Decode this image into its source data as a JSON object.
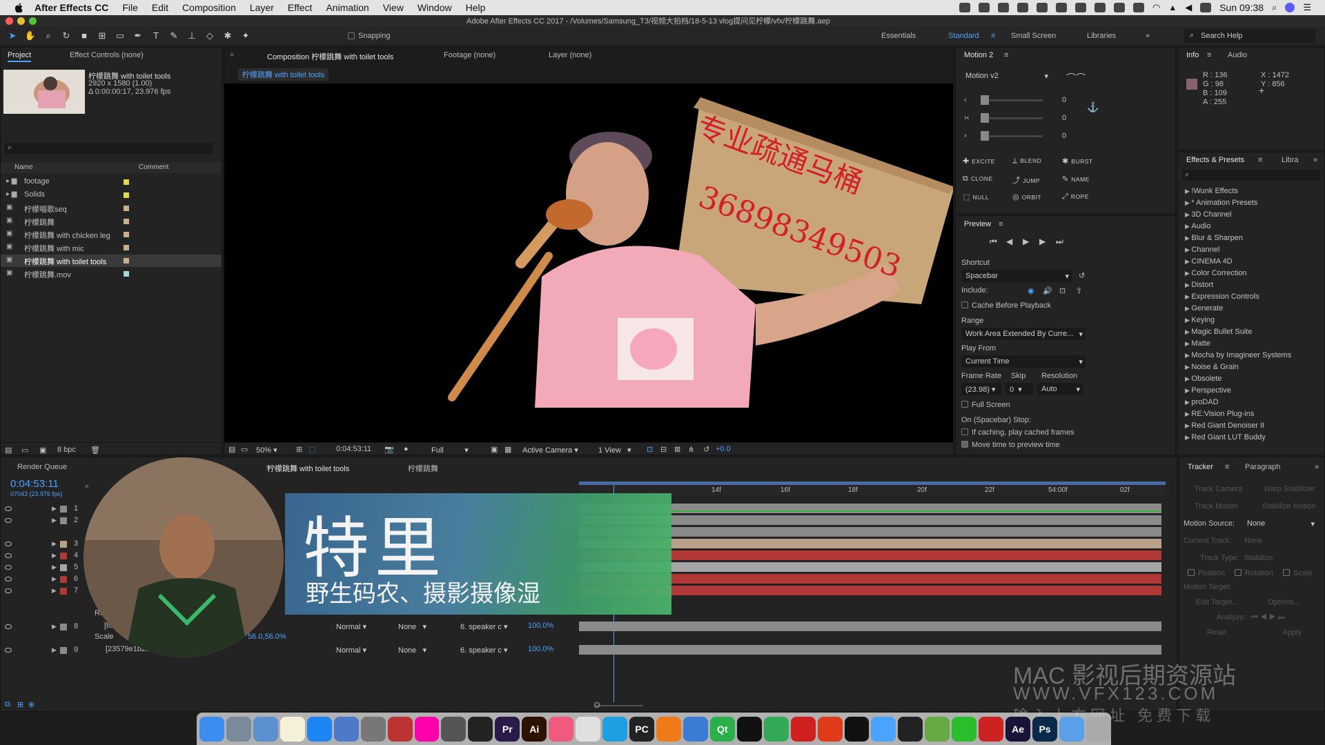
{
  "menubar": {
    "app": "After Effects CC",
    "items": [
      "File",
      "Edit",
      "Composition",
      "Layer",
      "Effect",
      "Animation",
      "View",
      "Window",
      "Help"
    ],
    "clock": "Sun 09:38"
  },
  "window_title": "Adobe After Effects CC 2017 - /Volumes/Samsung_T3/视频大拍档/18-5-13 vlog提问见柠檬/vfx/柠檬跳舞.aep",
  "toolbar": {
    "snapping_label": "Snapping",
    "workspaces": [
      "Essentials",
      "Standard",
      "Small Screen",
      "Libraries"
    ],
    "active_workspace": "Standard",
    "search_placeholder": "Search Help"
  },
  "project_panel": {
    "tabs": [
      "Project",
      "Effect Controls (none)"
    ],
    "selected_name": "柠檬跳舞 with toilet tools",
    "selected_dims": "2920 x 1580 (1.00)",
    "selected_duration": "Δ 0:00:00:17, 23.976 fps",
    "columns": [
      "Name",
      "Comment"
    ],
    "items": [
      {
        "name": "footage",
        "type": "folder",
        "color": "#e4d94b"
      },
      {
        "name": "Solids",
        "type": "folder",
        "color": "#e4d94b"
      },
      {
        "name": "柠檬唱歌seq",
        "type": "comp",
        "color": "#c8b08a"
      },
      {
        "name": "柠檬跳舞",
        "type": "comp",
        "color": "#c8b08a"
      },
      {
        "name": "柠檬跳舞 with chicken leg",
        "type": "comp",
        "color": "#c8b08a"
      },
      {
        "name": "柠檬跳舞 with mic",
        "type": "comp",
        "color": "#c8b08a"
      },
      {
        "name": "柠檬跳舞 with toilet tools",
        "type": "comp",
        "color": "#c8b08a"
      },
      {
        "name": "柠檬跳舞.mov",
        "type": "footage",
        "color": "#a8d8d8"
      }
    ],
    "bpc": "8 bpc"
  },
  "comp_panel": {
    "tabs": [
      "Composition 柠檬跳舞 with toilet tools",
      "Footage (none)",
      "Layer (none)"
    ],
    "breadcrumb": "柠檬跳舞 with toilet tools",
    "sign_text_top": "专业疏通马桶",
    "sign_text_phone": "36898349503",
    "zoom": "50%",
    "timecode": "0:04:53:11",
    "resolution": "Full",
    "camera": "Active Camera",
    "views": "1 View",
    "exposure": "+0.0"
  },
  "motion_panel": {
    "title": "Motion 2",
    "preset": "Motion v2",
    "slider_values": [
      "0",
      "0",
      "0"
    ],
    "buttons": [
      "EXCITE",
      "BLEND",
      "BURST",
      "CLONE",
      "JUMP",
      "NAME",
      "NULL",
      "ORBIT",
      "ROPE"
    ]
  },
  "preview_panel": {
    "title": "Preview",
    "shortcut_label": "Shortcut",
    "shortcut_value": "Spacebar",
    "include_label": "Include:",
    "cache_label": "Cache Before Playback",
    "range_label": "Range",
    "range_value": "Work Area Extended By Curre...",
    "play_from_label": "Play From",
    "play_from_value": "Current Time",
    "frame_rate_label": "Frame Rate",
    "skip_label": "Skip",
    "resolution_label": "Resolution",
    "frame_rate_value": "(23.98)",
    "skip_value": "0",
    "resolution_value": "Auto",
    "full_screen_label": "Full Screen",
    "on_stop_label": "On (Spacebar) Stop:",
    "if_caching_label": "If caching, play cached frames",
    "move_time_label": "Move time to preview time"
  },
  "info_panel": {
    "tabs": [
      "Info",
      "Audio"
    ],
    "r": "R : 136",
    "g": "G : 98",
    "b": "B : 109",
    "a": "A : 255",
    "x": "X : 1472",
    "y": "Y : 856",
    "swatch_color": "#88626d"
  },
  "effects_panel": {
    "tabs": [
      "Effects & Presets",
      "Libra"
    ],
    "items": [
      "!Wunk Effects",
      "* Animation Presets",
      "3D Channel",
      "Audio",
      "Blur & Sharpen",
      "Channel",
      "CINEMA 4D",
      "Color Correction",
      "Distort",
      "Expression Controls",
      "Generate",
      "Keying",
      "Magic Bullet Suite",
      "Matte",
      "Mocha by Imagineer Systems",
      "Noise & Grain",
      "Obsolete",
      "Perspective",
      "proDAD",
      "RE:Vision Plug-ins",
      "Red Giant Denoiser II",
      "Red Giant LUT Buddy"
    ]
  },
  "timeline": {
    "tabs": [
      "Render Queue",
      "柠檬跳舞 with toilet tools",
      "柠檬跳舞"
    ],
    "timecode": "0:04:53:11",
    "frame": "07043 (23.976 fps)",
    "ruler_labels": [
      "14f",
      "16f",
      "18f",
      "20f",
      "22f",
      "54:00f",
      "02f"
    ],
    "layer_numbers": [
      "1",
      "2",
      "3",
      "4",
      "5",
      "6",
      "7",
      "8",
      "9"
    ],
    "rot_label": "Rot",
    "scale_label": "Scale",
    "scale_value": "56.0,56.0%",
    "row8_name": "[tor",
    "row9_name": "[23579e1b2e96a12.jpg]",
    "blend_mode": "Normal",
    "trkmat": "None",
    "parent": "6. speaker c",
    "opacity": "100.0%"
  },
  "overlay": {
    "big_name": "特里",
    "subtitle": "野生码农、摄影摄像湿"
  },
  "tracker_panel": {
    "tabs": [
      "Tracker",
      "Paragraph"
    ],
    "track_camera": "Track Camera",
    "warp_stabilizer": "Warp Stabilizer",
    "track_motion": "Track Motion",
    "stabilize_motion": "Stabilize Motion",
    "motion_source_label": "Motion Source:",
    "motion_source_value": "None",
    "current_track_label": "Current Track:",
    "current_track_value": "None",
    "track_type_label": "Track Type:",
    "track_type_value": "Stabilize",
    "position": "Position",
    "rotation": "Rotation",
    "scale": "Scale",
    "motion_target": "Motion Target:",
    "edit_target": "Edit Target...",
    "options": "Options...",
    "analyze": "Analyze:",
    "reset": "Reset",
    "apply": "Apply"
  },
  "watermark": {
    "line1": "MAC 影视后期资源站",
    "line2": "WWW.VFX123.COM",
    "line3": "输入上方网址 免费下载"
  },
  "dock_apps": [
    "Finder",
    "Launchpad",
    "Mail",
    "Notes",
    "App Store",
    "Preview",
    "System Preferences",
    "Dictionary",
    "Photos",
    "Final Cut",
    "DaVinci",
    "Pr",
    "Ai",
    "iTunes",
    "Chrome",
    "QQ Browser",
    "PC",
    "Sublime",
    "Xcode",
    "Qt",
    "Terminal",
    "WeChat Work",
    "NetEase",
    "Taobao",
    "QQ",
    "Finder2",
    "Activity",
    "Game",
    "WeChat",
    "Cloud",
    "Ae",
    "Ps",
    "Folder",
    "Trash"
  ]
}
